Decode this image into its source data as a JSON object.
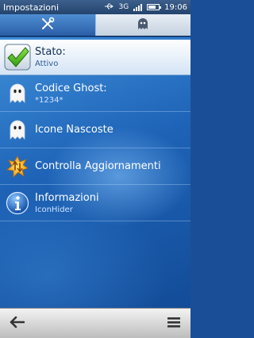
{
  "status_bar": {
    "title": "Impostazioni",
    "network": "3G",
    "time": "19:06"
  },
  "tabs": [
    {
      "name": "settings",
      "icon": "wrench-screwdriver-icon",
      "active": true
    },
    {
      "name": "ghost",
      "icon": "ghost-icon",
      "active": false
    }
  ],
  "items": [
    {
      "title": "Stato:",
      "subtitle": "Attivo",
      "icon": "checkmark-icon",
      "selected": true
    },
    {
      "title": "Codice Ghost:",
      "subtitle": "*1234*",
      "icon": "ghost-icon"
    },
    {
      "title": "Icone Nascoste",
      "subtitle": "",
      "icon": "ghost-icon"
    },
    {
      "title": "Controlla Aggiornamenti",
      "subtitle": "",
      "icon": "update-icon"
    },
    {
      "title": "Informazioni",
      "subtitle": "IconHider",
      "icon": "info-icon"
    }
  ],
  "toolbar": {
    "back_icon": "back-arrow-icon",
    "menu_icon": "menu-icon"
  },
  "colors": {
    "background": "#1e63b7",
    "selected_item": "#ffffff",
    "active_tab": "#3f7cc4",
    "toolbar": "#d9d9d9"
  }
}
